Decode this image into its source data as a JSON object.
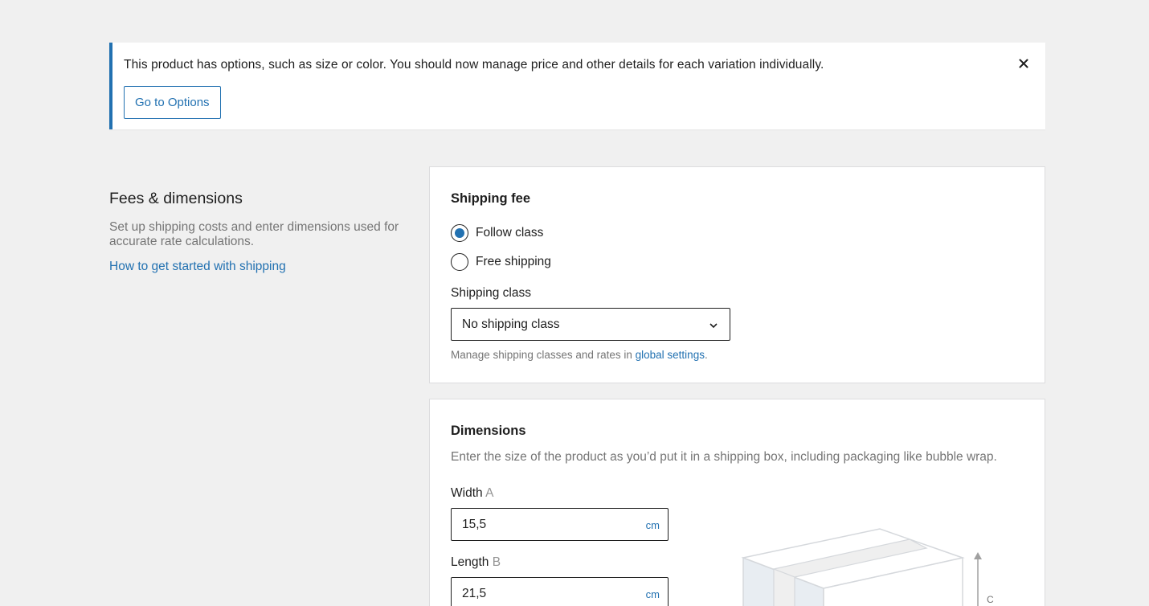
{
  "notice": {
    "text": "This product has options, such as size or color. You should now manage price and other details for each variation individually.",
    "button_label": "Go to Options"
  },
  "section": {
    "title": "Fees & dimensions",
    "description": "Set up shipping costs and enter dimensions used for accurate rate calculations.",
    "link": "How to get started with shipping"
  },
  "shipping_fee": {
    "title": "Shipping fee",
    "options": [
      {
        "label": "Follow class",
        "checked": true
      },
      {
        "label": "Free shipping",
        "checked": false
      }
    ],
    "class_label": "Shipping class",
    "class_value": "No shipping class",
    "help_prefix": "Manage shipping classes and rates in ",
    "help_link": "global settings",
    "help_suffix": "."
  },
  "dimensions": {
    "title": "Dimensions",
    "description": "Enter the size of the product as you’d put it in a shipping box, including packaging like bubble wrap.",
    "width": {
      "label": "Width",
      "hint": "A",
      "value": "15,5",
      "unit": "cm"
    },
    "length": {
      "label": "Length",
      "hint": "B",
      "value": "21,5",
      "unit": "cm"
    },
    "illustration_label": "C"
  },
  "colors": {
    "accent": "#2271b1",
    "background": "#f0f0f0",
    "muted_text": "#757575"
  }
}
